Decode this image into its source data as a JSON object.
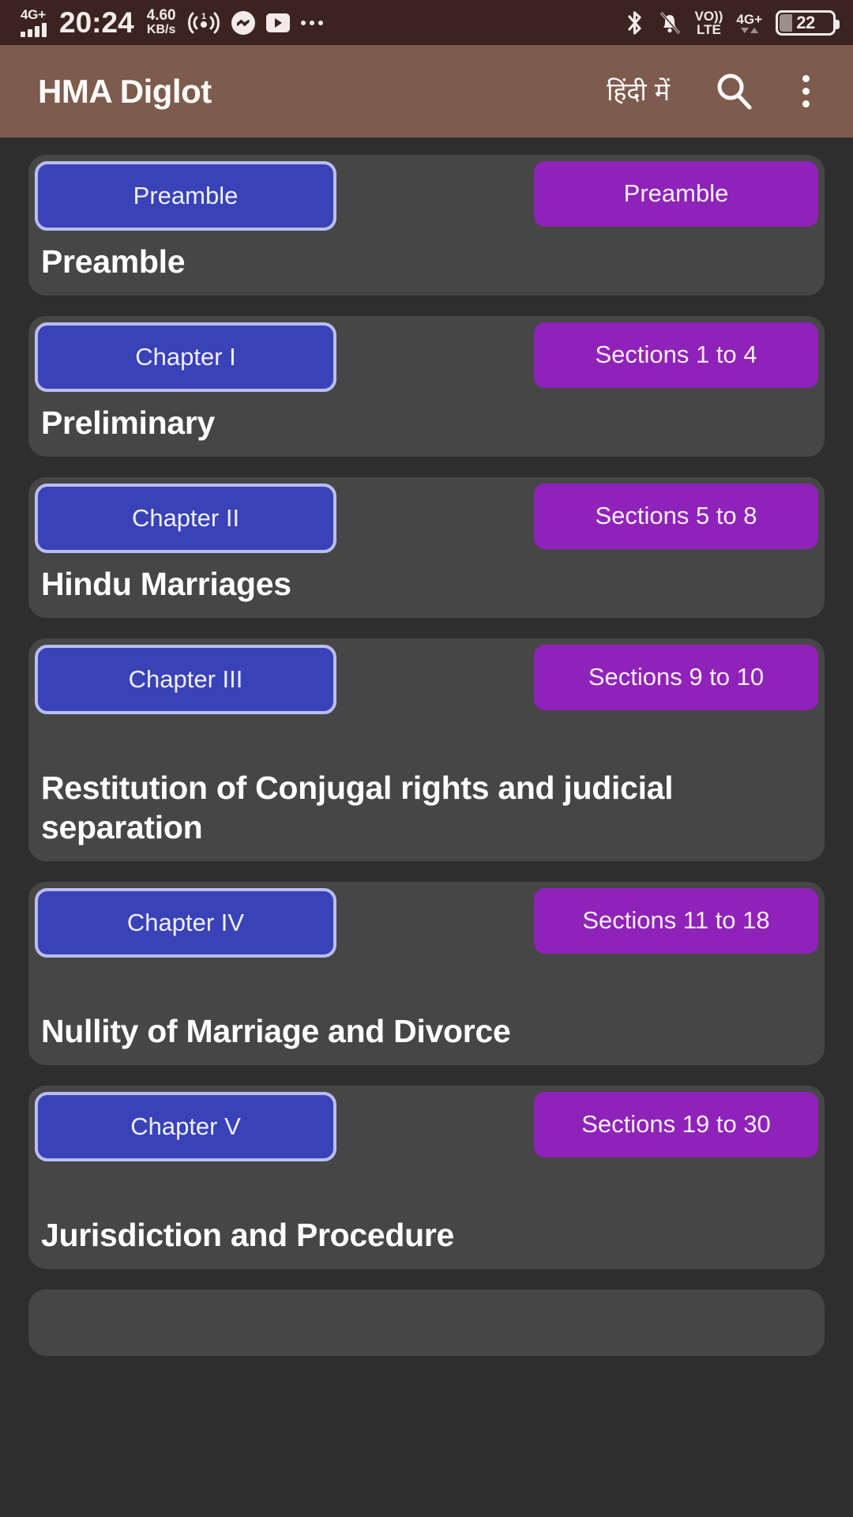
{
  "status_bar": {
    "network_label": "4G+",
    "signal_bars": 4,
    "time": "20:24",
    "data_speed_value": "4.60",
    "data_speed_unit": "KB/s",
    "hotspot_count": "1",
    "icons_left": [
      "signal-icon",
      "hotspot-icon",
      "messenger-icon",
      "youtube-icon",
      "more-icon"
    ],
    "icons_right": [
      "bluetooth-icon",
      "mute-bell-icon",
      "volte-icon",
      "signal2-icon",
      "battery-icon"
    ],
    "volte_top": "VO))",
    "volte_bottom": "LTE",
    "network_label_right": "4G+",
    "battery_percent": "22"
  },
  "app_bar": {
    "title": "HMA Diglot",
    "language_toggle": "हिंदी में",
    "search_icon": "search-icon",
    "overflow_icon": "more-vert-icon",
    "background_color": "#7d5c4d"
  },
  "theme": {
    "page_background": "#2e2e2e",
    "card_background": "#464646",
    "chip_blue": "#3a42b8",
    "chip_blue_border": "#b9bef0",
    "chip_purple": "#8f22b8",
    "status_bar_background": "#3b2420"
  },
  "list": {
    "items": [
      {
        "chapter": "Preamble",
        "sections": "Preamble",
        "title": "Preamble",
        "two_line_sections": false,
        "wrap_title": false
      },
      {
        "chapter": "Chapter I",
        "sections": "Sections 1 to 4",
        "title": "Preliminary",
        "two_line_sections": false,
        "wrap_title": false
      },
      {
        "chapter": "Chapter II",
        "sections": "Sections 5 to 8",
        "title": "Hindu Marriages",
        "two_line_sections": false,
        "wrap_title": false
      },
      {
        "chapter": "Chapter III",
        "sections": "Sections 9 to 10",
        "title": "Restitution of Conjugal rights and judicial separation",
        "two_line_sections": true,
        "wrap_title": true
      },
      {
        "chapter": "Chapter IV",
        "sections": "Sections 11 to 18",
        "title": "Nullity of Marriage and Divorce",
        "two_line_sections": true,
        "wrap_title": false
      },
      {
        "chapter": "Chapter V",
        "sections": "Sections 19 to 30",
        "title": "Jurisdiction and Procedure",
        "two_line_sections": true,
        "wrap_title": false
      }
    ]
  }
}
